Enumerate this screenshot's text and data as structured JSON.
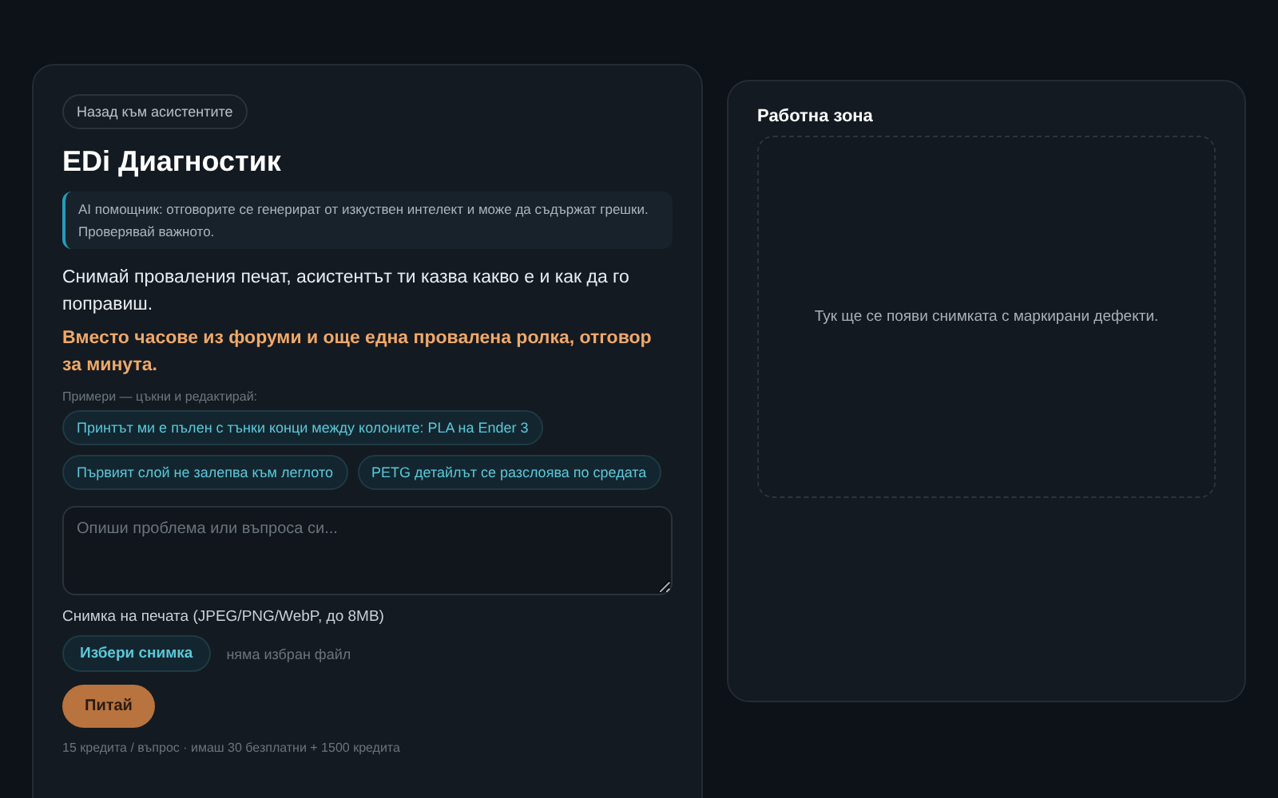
{
  "back_link": "Назад към асистентите",
  "title": "EDi Диагностик",
  "notice": "AI помощник: отговорите се генерират от изкуствен интелект и може да съдържат грешки. Проверявай важното.",
  "intro": "Снимай проваления печат, асистентът ти казва какво е и как да го поправиш.",
  "highlight": "Вместо часове из форуми и още една провалена ролка, отговор за минута.",
  "examples_label": "Примери — цъкни и редактирай:",
  "examples": [
    "Принтът ми е пълен с тънки конци между колоните: PLA на Ender 3",
    "Първият слой не залепва към леглото",
    "PETG детайлът се разслоява по средата"
  ],
  "question": {
    "placeholder": "Опиши проблема или въпроса си..."
  },
  "photo_label": "Снимка на печата (JPEG/PNG/WebP, до 8MB)",
  "choose_button": "Избери снимка",
  "file_status": "няма избран файл",
  "ask_button": "Питай",
  "credits_note": "15 кредита / въпрос · имаш 30 безплатни + 1500 кредита",
  "workspace": {
    "title": "Работна зона",
    "empty_text": "Тук ще се появи снимката с маркирани дефекти."
  }
}
